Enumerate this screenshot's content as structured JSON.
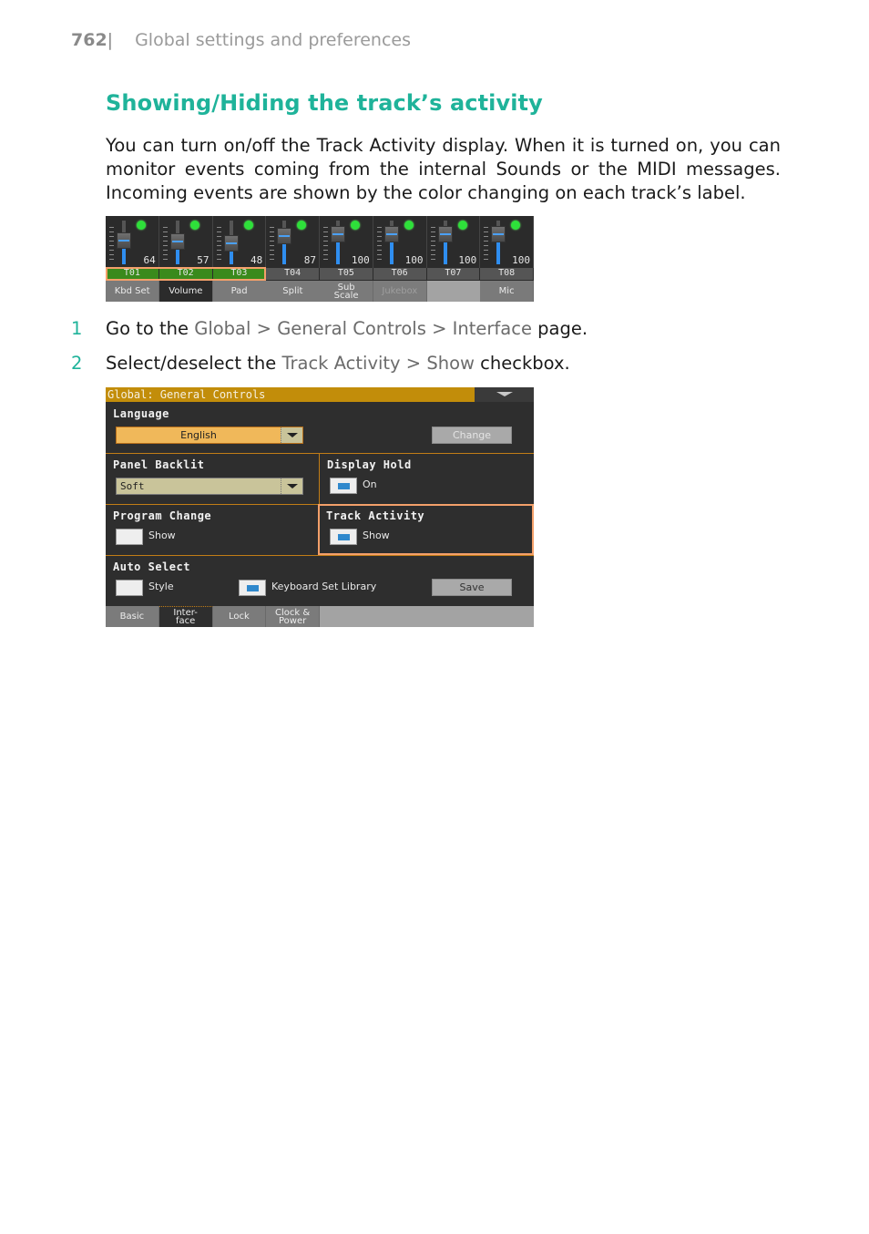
{
  "header": {
    "page_number": "762",
    "separator": "|",
    "chapter": "Global settings and preferences"
  },
  "section_title": "Showing/Hiding the track’s activity",
  "paragraph": "You can turn on/off the Track Activity display. When it is turned on, you can monitor events coming from the internal Sounds or the MIDI messages. Incoming events are shown by the color changing on each track’s label.",
  "mixer": {
    "strips": [
      {
        "value": "64",
        "level": 64
      },
      {
        "value": "57",
        "level": 57
      },
      {
        "value": "48",
        "level": 48
      },
      {
        "value": "87",
        "level": 87
      },
      {
        "value": "100",
        "level": 100
      },
      {
        "value": "100",
        "level": 100
      },
      {
        "value": "100",
        "level": 100
      },
      {
        "value": "100",
        "level": 100
      }
    ],
    "track_labels": [
      {
        "label": "T01",
        "active": true
      },
      {
        "label": "T02",
        "active": true
      },
      {
        "label": "T03",
        "active": true
      },
      {
        "label": "T04",
        "active": false
      },
      {
        "label": "T05",
        "active": false
      },
      {
        "label": "T06",
        "active": false
      },
      {
        "label": "T07",
        "active": false
      },
      {
        "label": "T08",
        "active": false
      }
    ],
    "tabs": [
      {
        "label": "Kbd Set",
        "state": "normal"
      },
      {
        "label": "Volume",
        "state": "selected"
      },
      {
        "label": "Pad",
        "state": "normal"
      },
      {
        "label": "Split",
        "state": "normal"
      },
      {
        "label": "Sub Scale",
        "state": "normal"
      },
      {
        "label": "Jukebox",
        "state": "dim"
      },
      {
        "label": "",
        "state": "empty"
      },
      {
        "label": "Mic",
        "state": "normal"
      }
    ],
    "colors": {
      "active_label": "#3a8a1c",
      "led": "#2ee03a",
      "fader_fill": "#2f8ef0",
      "highlight": "#f4a06a"
    }
  },
  "steps": [
    {
      "number": "1",
      "parts": [
        "Go to the ",
        "Global",
        " > ",
        "General Controls",
        " > ",
        "Interface",
        " page."
      ]
    },
    {
      "number": "2",
      "parts": [
        "Select/deselect the ",
        "Track Activity",
        " > ",
        "Show",
        " checkbox."
      ]
    }
  ],
  "global_controls": {
    "title": "Global: General Controls",
    "language": {
      "label": "Language",
      "value": "English",
      "change_button": "Change"
    },
    "panel_backlit": {
      "label": "Panel Backlit",
      "value": "Soft"
    },
    "display_hold": {
      "label": "Display Hold",
      "checkbox_label": "On",
      "checked": true
    },
    "program_change": {
      "label": "Program Change",
      "checkbox_label": "Show",
      "checked": false
    },
    "track_activity": {
      "label": "Track Activity",
      "checkbox_label": "Show",
      "checked": true
    },
    "auto_select": {
      "label": "Auto Select",
      "style_label": "Style",
      "style_checked": false,
      "kbd_label": "Keyboard Set Library",
      "kbd_checked": true,
      "save_button": "Save"
    },
    "tabs": [
      {
        "label": "Basic",
        "selected": false
      },
      {
        "label": "Inter-\nface",
        "selected": true
      },
      {
        "label": "Lock",
        "selected": false
      },
      {
        "label": "Clock &\nPower",
        "selected": false
      }
    ],
    "colors": {
      "title_bar": "#c28d0a",
      "language_field": "#f0b85a",
      "backlit_field": "#c9c49a",
      "checkbox_fill": "#2f88cc",
      "highlight": "#f4a06a"
    }
  }
}
